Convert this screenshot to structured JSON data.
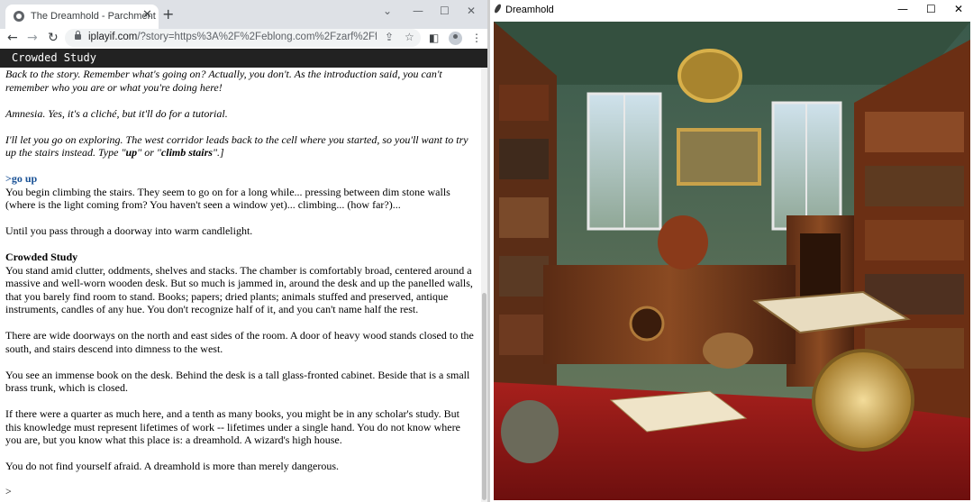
{
  "browser": {
    "tab_title": "The Dreamhold - Parchment",
    "tab_close": "✕",
    "new_tab": "+",
    "url_host": "iplayif.com",
    "url_rest": "/?story=https%3A%2F%2Feblong.com%2Fzarf%2Fftp%2Fdrea...",
    "status_title": "Crowded Study"
  },
  "story": {
    "intro1": "Back to the story. Remember what's going on? Actually, you don't. As the introduction said, you can't remember who you are or what you're doing here!",
    "intro2": "Amnesia. Yes, it's a cliché, but it'll do for a tutorial.",
    "intro3_a": "I'll let you go on exploring. The west corridor leads back to the cell where you started, so you'll want to try up the stairs instead. Type \"",
    "intro3_up": "up",
    "intro3_b": "\" or \"",
    "intro3_climb": "climb stairs",
    "intro3_c": "\".]",
    "command": ">go up",
    "climb": "You begin climbing the stairs. They seem to go on for a long while... pressing between dim stone walls (where is the light coming from? You haven't seen a window yet)... climbing... (how far?)...",
    "pass": "Until you pass through a doorway into warm candlelight.",
    "room_name": "Crowded Study",
    "room_desc": "You stand amid clutter, oddments, shelves and stacks. The chamber is comfortably broad, centered around a massive and well-worn wooden desk. But so much is jammed in, around the desk and up the panelled walls, that you barely find room to stand. Books; papers; dried plants; animals stuffed and preserved, antique instruments, candles of any hue. You don't recognize half of it, and you can't name half the rest.",
    "exits": "There are wide doorways on the north and east sides of the room. A door of heavy wood stands closed to the south, and stairs descend into dimness to the west.",
    "objects": "You see an immense book on the desk. Behind the desk is a tall glass-fronted cabinet. Beside that is a small brass trunk, which is closed.",
    "scholar": "If there were a quarter as much here, and a tenth as many books, you might be in any scholar's study. But this knowledge must represent lifetimes of work -- lifetimes under a single hand. You do not know where you are, but you know what this place is: a dreamhold. A wizard's high house.",
    "afraid": "You do not find yourself afraid. A dreamhold is more than merely dangerous.",
    "prompt": ">"
  },
  "image_window": {
    "title": "Dreamhold"
  }
}
